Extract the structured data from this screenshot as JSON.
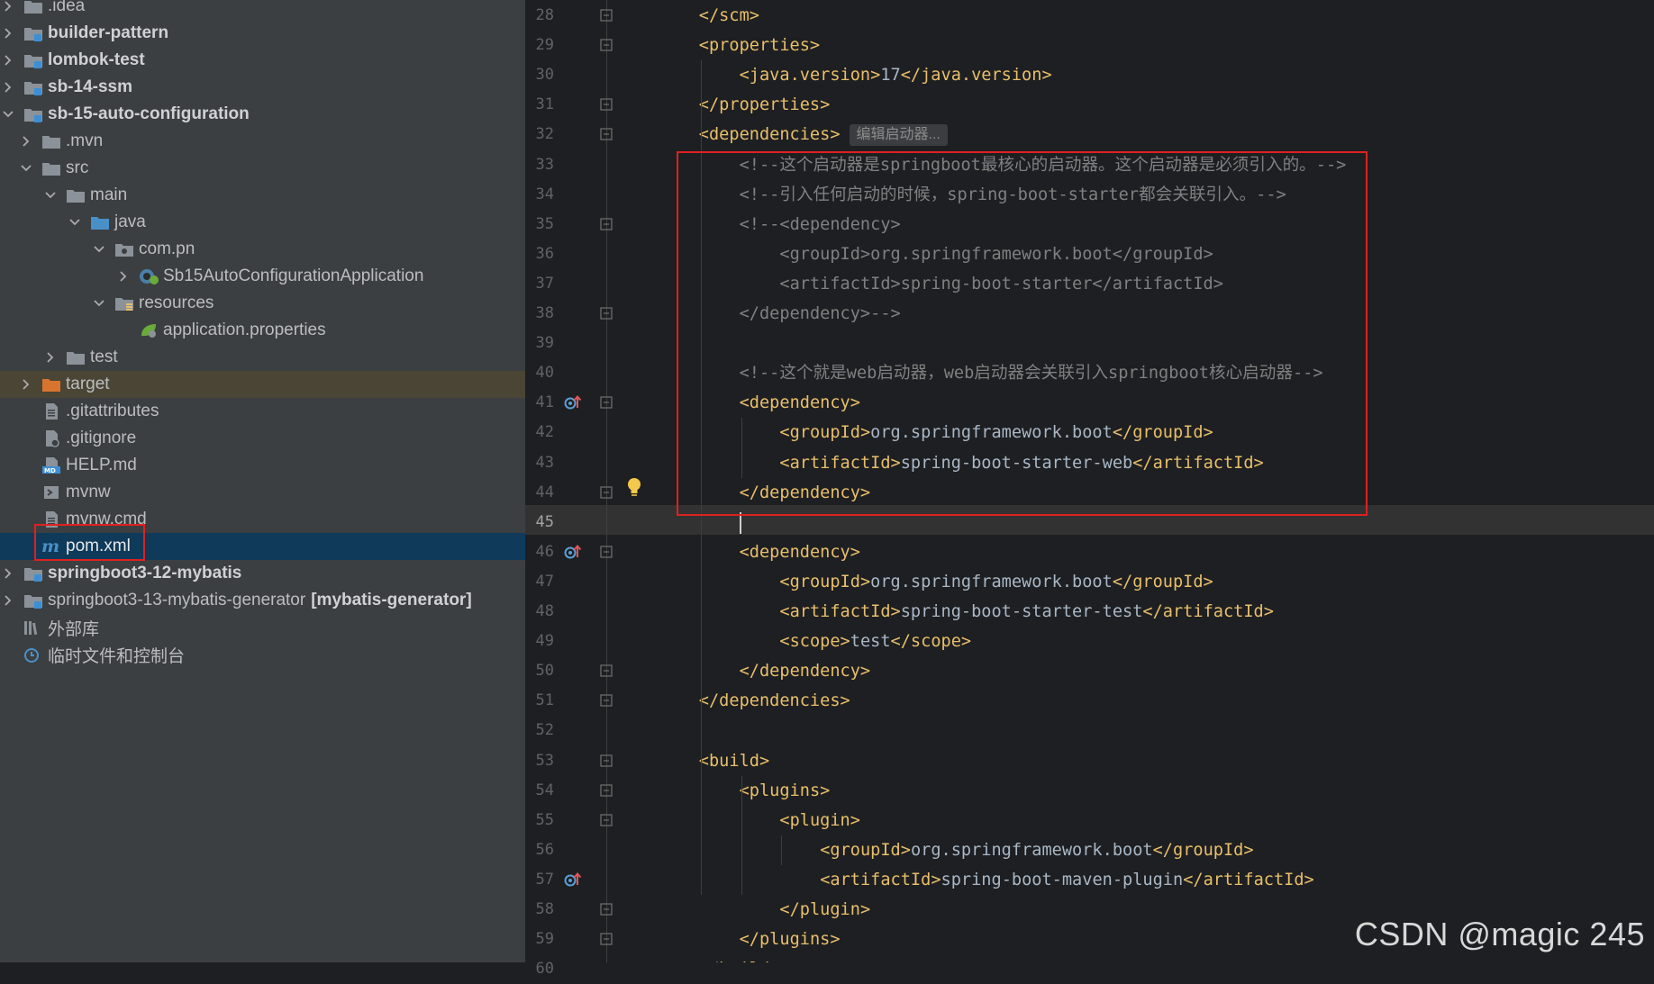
{
  "project_tree": {
    "items": [
      {
        "label": ".idea",
        "bold": false,
        "icon": "folder-icon",
        "arrow": "right"
      },
      {
        "label": "builder-pattern",
        "bold": true,
        "icon": "module-icon",
        "arrow": "right"
      },
      {
        "label": "lombok-test",
        "bold": true,
        "icon": "module-icon",
        "arrow": "right"
      },
      {
        "label": "sb-14-ssm",
        "bold": true,
        "icon": "module-icon",
        "arrow": "right"
      },
      {
        "label": "sb-15-auto-configuration",
        "bold": true,
        "icon": "module-icon",
        "arrow": "down"
      },
      {
        "label": ".mvn",
        "bold": false,
        "icon": "folder-icon",
        "arrow": "right"
      },
      {
        "label": "src",
        "bold": false,
        "icon": "folder-icon",
        "arrow": "down"
      },
      {
        "label": "main",
        "bold": false,
        "icon": "folder-icon",
        "arrow": "down"
      },
      {
        "label": "java",
        "bold": false,
        "icon": "source-folder-icon",
        "arrow": "down"
      },
      {
        "label": "com.pn",
        "bold": false,
        "icon": "package-icon",
        "arrow": "down"
      },
      {
        "label": "Sb15AutoConfigurationApplication",
        "bold": false,
        "icon": "spring-boot-class-icon",
        "arrow": "right"
      },
      {
        "label": "resources",
        "bold": false,
        "icon": "resources-folder-icon",
        "arrow": "down"
      },
      {
        "label": "application.properties",
        "bold": false,
        "icon": "spring-properties-icon",
        "arrow": "none"
      },
      {
        "label": "test",
        "bold": false,
        "icon": "folder-icon",
        "arrow": "right"
      },
      {
        "label": "target",
        "bold": false,
        "icon": "excluded-folder-icon",
        "arrow": "right"
      },
      {
        "label": ".gitattributes",
        "bold": false,
        "icon": "text-file-icon",
        "arrow": "none"
      },
      {
        "label": ".gitignore",
        "bold": false,
        "icon": "gitignore-file-icon",
        "arrow": "none"
      },
      {
        "label": "HELP.md",
        "bold": false,
        "icon": "markdown-file-icon",
        "arrow": "none"
      },
      {
        "label": "mvnw",
        "bold": false,
        "icon": "shell-script-icon",
        "arrow": "none"
      },
      {
        "label": "mvnw.cmd",
        "bold": false,
        "icon": "text-file-icon",
        "arrow": "none"
      },
      {
        "label": "pom.xml",
        "bold": false,
        "icon": "maven-pom-icon",
        "arrow": "none"
      },
      {
        "label": "springboot3-12-mybatis",
        "bold": true,
        "icon": "module-icon",
        "arrow": "right"
      },
      {
        "label": "springboot3-13-mybatis-generator",
        "bold": false,
        "badge": "[mybatis-generator]",
        "icon": "module-icon",
        "arrow": "right"
      },
      {
        "label": "外部库",
        "bold": false,
        "icon": "external-libraries-icon",
        "arrow": "none"
      },
      {
        "label": "临时文件和控制台",
        "bold": false,
        "icon": "scratches-icon",
        "arrow": "none"
      }
    ]
  },
  "editor": {
    "inlay_hint": "编辑启动器...",
    "current_line": "45",
    "lines": [
      {
        "num": "28",
        "segments": [
          [
            "tag",
            "</scm>"
          ]
        ]
      },
      {
        "num": "29",
        "segments": [
          [
            "tag",
            "<properties>"
          ]
        ]
      },
      {
        "num": "30",
        "segments": [
          [
            "tag",
            "<java.version>"
          ],
          [
            "txt",
            "17"
          ],
          [
            "tag",
            "</java.version>"
          ]
        ]
      },
      {
        "num": "31",
        "segments": [
          [
            "tag",
            "</properties>"
          ]
        ]
      },
      {
        "num": "32",
        "segments": [
          [
            "tag",
            "<dependencies>"
          ]
        ]
      },
      {
        "num": "33",
        "segments": [
          [
            "cmt",
            "<!--这个启动器是springboot最核心的启动器。这个启动器是必须引入的。-->"
          ]
        ]
      },
      {
        "num": "34",
        "segments": [
          [
            "cmt",
            "<!--引入任何启动的时候，spring-boot-starter都会关联引入。-->"
          ]
        ]
      },
      {
        "num": "35",
        "segments": [
          [
            "cmt",
            "<!--<dependency>"
          ]
        ]
      },
      {
        "num": "36",
        "segments": [
          [
            "cmt",
            "<groupId>org.springframework.boot</groupId>"
          ]
        ]
      },
      {
        "num": "37",
        "segments": [
          [
            "cmt",
            "<artifactId>spring-boot-starter</artifactId>"
          ]
        ]
      },
      {
        "num": "38",
        "segments": [
          [
            "cmt",
            "</dependency>-->"
          ]
        ]
      },
      {
        "num": "39",
        "segments": []
      },
      {
        "num": "40",
        "segments": [
          [
            "cmt",
            "<!--这个就是web启动器，web启动器会关联引入springboot核心启动器-->"
          ]
        ]
      },
      {
        "num": "41",
        "segments": [
          [
            "tag",
            "<dependency>"
          ]
        ]
      },
      {
        "num": "42",
        "segments": [
          [
            "tag",
            "<groupId>"
          ],
          [
            "txt",
            "org.springframework.boot"
          ],
          [
            "tag",
            "</groupId>"
          ]
        ]
      },
      {
        "num": "43",
        "segments": [
          [
            "tag",
            "<artifactId>"
          ],
          [
            "txt",
            "spring-boot-starter-web"
          ],
          [
            "tag",
            "</artifactId>"
          ]
        ]
      },
      {
        "num": "44",
        "segments": [
          [
            "tag",
            "</dependency>"
          ]
        ]
      },
      {
        "num": "45",
        "segments": []
      },
      {
        "num": "46",
        "segments": [
          [
            "tag",
            "<dependency>"
          ]
        ]
      },
      {
        "num": "47",
        "segments": [
          [
            "tag",
            "<groupId>"
          ],
          [
            "txt",
            "org.springframework.boot"
          ],
          [
            "tag",
            "</groupId>"
          ]
        ]
      },
      {
        "num": "48",
        "segments": [
          [
            "tag",
            "<artifactId>"
          ],
          [
            "txt",
            "spring-boot-starter-test"
          ],
          [
            "tag",
            "</artifactId>"
          ]
        ]
      },
      {
        "num": "49",
        "segments": [
          [
            "tag",
            "<scope>"
          ],
          [
            "txt",
            "test"
          ],
          [
            "tag",
            "</scope>"
          ]
        ]
      },
      {
        "num": "50",
        "segments": [
          [
            "tag",
            "</dependency>"
          ]
        ]
      },
      {
        "num": "51",
        "segments": [
          [
            "tag",
            "</dependencies>"
          ]
        ]
      },
      {
        "num": "52",
        "segments": []
      },
      {
        "num": "53",
        "segments": [
          [
            "tag",
            "<build>"
          ]
        ]
      },
      {
        "num": "54",
        "segments": [
          [
            "tag",
            "<plugins>"
          ]
        ]
      },
      {
        "num": "55",
        "segments": [
          [
            "tag",
            "<plugin>"
          ]
        ]
      },
      {
        "num": "56",
        "segments": [
          [
            "tag",
            "<groupId>"
          ],
          [
            "txt",
            "org.springframework.boot"
          ],
          [
            "tag",
            "</groupId>"
          ]
        ]
      },
      {
        "num": "57",
        "segments": [
          [
            "tag",
            "<artifactId>"
          ],
          [
            "txt",
            "spring-boot-maven-plugin"
          ],
          [
            "tag",
            "</artifactId>"
          ]
        ]
      },
      {
        "num": "58",
        "segments": [
          [
            "tag",
            "</plugin>"
          ]
        ]
      },
      {
        "num": "59",
        "segments": [
          [
            "tag",
            "</plugins>"
          ]
        ]
      },
      {
        "num": "60",
        "segments": [
          [
            "tag",
            "</build>"
          ]
        ]
      }
    ]
  },
  "watermark": "CSDN @magic 245",
  "colors": {
    "tree_bg": "#3c3f41",
    "editor_bg": "#2b2b2b",
    "xml_tag": "#e8bf6a",
    "comment": "#808080",
    "text": "#a9b7c6",
    "selection": "#0f3a5a",
    "annotation_box": "#e02020"
  }
}
